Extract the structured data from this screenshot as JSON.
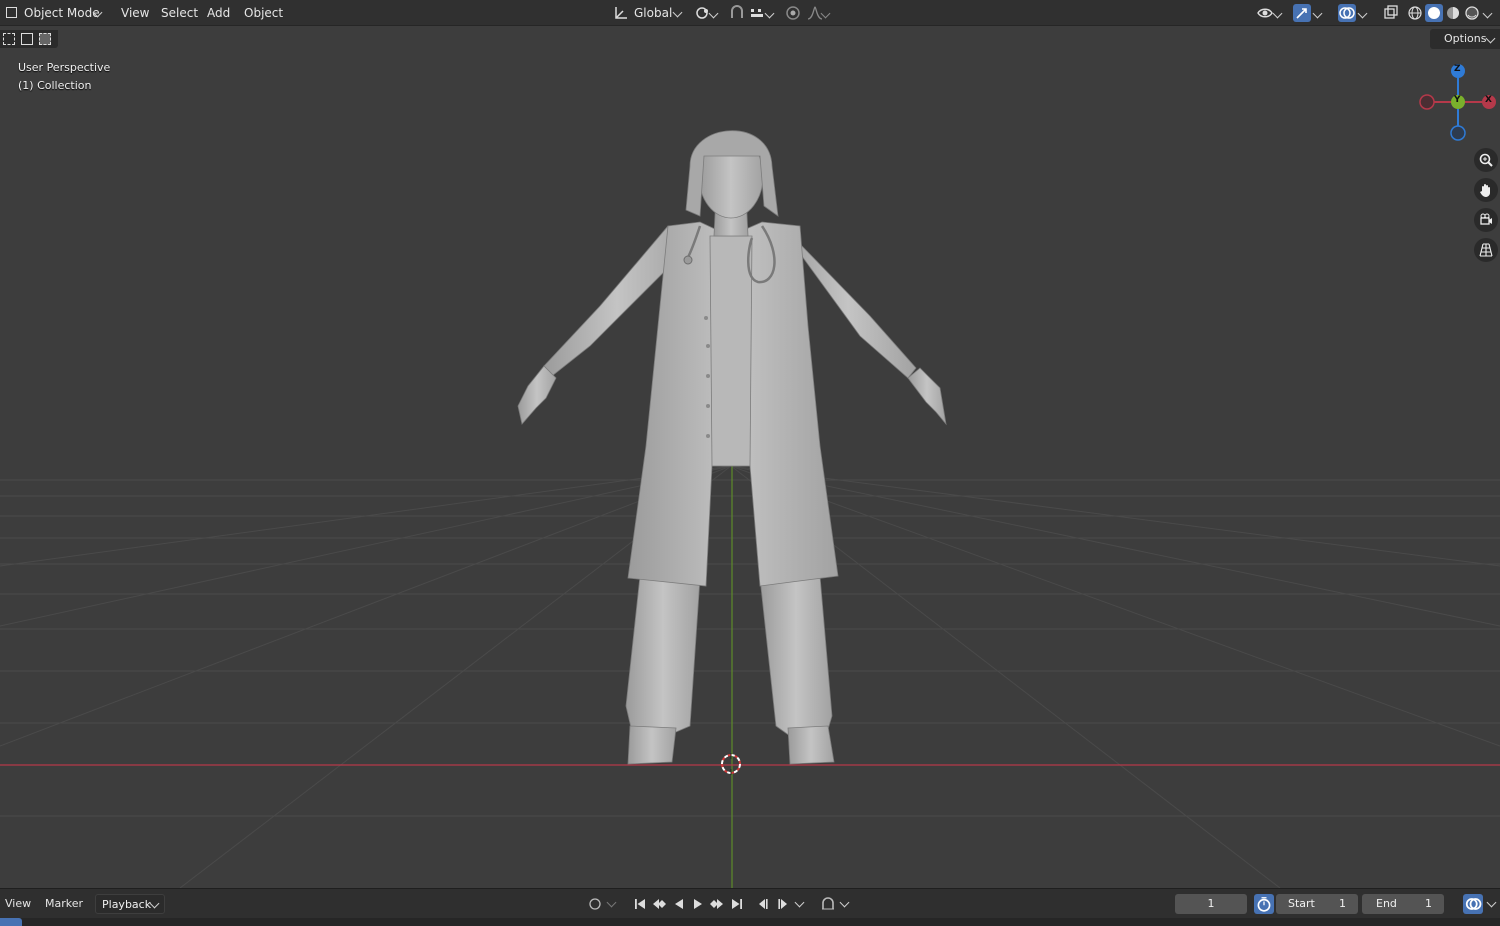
{
  "header": {
    "mode_label": "Object Mode",
    "menu": [
      "View",
      "Select",
      "Add",
      "Object"
    ],
    "transform_orientation": "Global"
  },
  "viewport": {
    "view_name": "User Perspective",
    "collection_label": "(1) Collection",
    "options_label": "Options",
    "gizmo": {
      "z": "Z",
      "y": "Y",
      "x": "X"
    }
  },
  "timeline": {
    "menu": [
      "View",
      "Marker",
      "Playback"
    ],
    "current_frame": "1",
    "start_label": "Start",
    "start_value": "1",
    "end_label": "End",
    "end_value": "1"
  },
  "colors": {
    "x_axis": "#b5394a",
    "y_axis": "#5e8c2a",
    "z_axis": "#2f7bd6",
    "accent": "#4772b3"
  }
}
